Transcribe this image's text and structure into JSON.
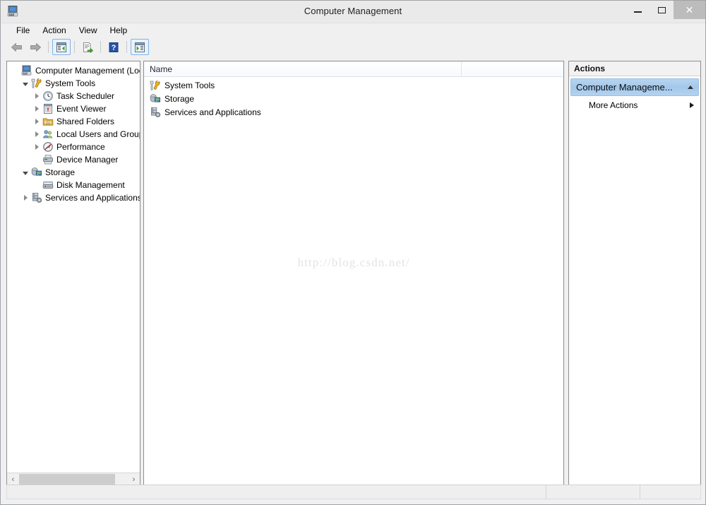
{
  "window": {
    "title": "Computer Management",
    "icon": "computer-management-icon",
    "controls": {
      "minimize": "minimize-icon",
      "maximize": "maximize-icon",
      "close": "close-icon",
      "close_glyph": "✕"
    }
  },
  "menubar": {
    "items": [
      {
        "label": "File",
        "name": "menu-file"
      },
      {
        "label": "Action",
        "name": "menu-action"
      },
      {
        "label": "View",
        "name": "menu-view"
      },
      {
        "label": "Help",
        "name": "menu-help"
      }
    ]
  },
  "toolbar": {
    "buttons": [
      {
        "name": "back-button",
        "icon": "back-arrow-icon",
        "framed": false
      },
      {
        "name": "forward-button",
        "icon": "forward-arrow-icon",
        "framed": false
      },
      {
        "name": "show-hide-console-tree-button",
        "icon": "console-tree-icon",
        "framed": true
      },
      {
        "name": "export-list-button",
        "icon": "export-list-icon",
        "framed": false
      },
      {
        "name": "help-button",
        "icon": "question-mark-icon",
        "framed": false
      },
      {
        "name": "show-hide-action-pane-button",
        "icon": "action-pane-icon",
        "framed": true
      }
    ]
  },
  "tree": {
    "items": [
      {
        "label": "Computer Management (Local",
        "level": 0,
        "expander": "expanded",
        "icon": "computer-icon",
        "name": "tree-item-computer-management"
      },
      {
        "label": "System Tools",
        "level": 1,
        "expander": "expanded",
        "icon": "system-tools-icon",
        "name": "tree-item-system-tools"
      },
      {
        "label": "Task Scheduler",
        "level": 2,
        "expander": "collapsed",
        "icon": "clock-icon",
        "name": "tree-item-task-scheduler"
      },
      {
        "label": "Event Viewer",
        "level": 2,
        "expander": "collapsed",
        "icon": "event-viewer-icon",
        "name": "tree-item-event-viewer"
      },
      {
        "label": "Shared Folders",
        "level": 2,
        "expander": "collapsed",
        "icon": "shared-folders-icon",
        "name": "tree-item-shared-folders"
      },
      {
        "label": "Local Users and Groups",
        "level": 2,
        "expander": "collapsed",
        "icon": "users-groups-icon",
        "name": "tree-item-local-users-and-groups"
      },
      {
        "label": "Performance",
        "level": 2,
        "expander": "collapsed",
        "icon": "performance-icon",
        "name": "tree-item-performance"
      },
      {
        "label": "Device Manager",
        "level": 2,
        "expander": "none",
        "icon": "device-manager-icon",
        "name": "tree-item-device-manager"
      },
      {
        "label": "Storage",
        "level": 1,
        "expander": "expanded",
        "icon": "storage-icon",
        "name": "tree-item-storage"
      },
      {
        "label": "Disk Management",
        "level": 2,
        "expander": "none",
        "icon": "disk-management-icon",
        "name": "tree-item-disk-management"
      },
      {
        "label": "Services and Applications",
        "level": 1,
        "expander": "collapsed",
        "icon": "services-icon",
        "name": "tree-item-services-and-applications"
      }
    ],
    "scrollbar": {
      "left_arrow": "‹",
      "right_arrow": "›"
    }
  },
  "list": {
    "columns": [
      {
        "label": "Name",
        "name": "column-header-name"
      },
      {
        "label": "",
        "name": "column-header-blank"
      }
    ],
    "rows": [
      {
        "label": "System Tools",
        "icon": "system-tools-icon",
        "name": "list-item-system-tools"
      },
      {
        "label": "Storage",
        "icon": "storage-icon",
        "name": "list-item-storage"
      },
      {
        "label": "Services and Applications",
        "icon": "services-icon",
        "name": "list-item-services-and-applications"
      }
    ],
    "watermark": "http://blog.csdn.net/"
  },
  "actions": {
    "header": "Actions",
    "selected": {
      "label": "Computer Manageme...",
      "caret": "caret-up-icon"
    },
    "items": [
      {
        "label": "More Actions",
        "caret": "caret-right-icon",
        "name": "actions-item-more-actions"
      }
    ]
  },
  "statusbar": {
    "segments": [
      "",
      "",
      ""
    ]
  },
  "colors": {
    "window_chrome": "#f0f0f0",
    "titlebar": "#eaeaea",
    "panel_border": "#8d8d8d",
    "actions_selected": "#a9cbea",
    "toolbar_framed": "#7eb4ea",
    "watermark": "#e4e4e4",
    "close_button_bg": "#bcbcbc"
  }
}
